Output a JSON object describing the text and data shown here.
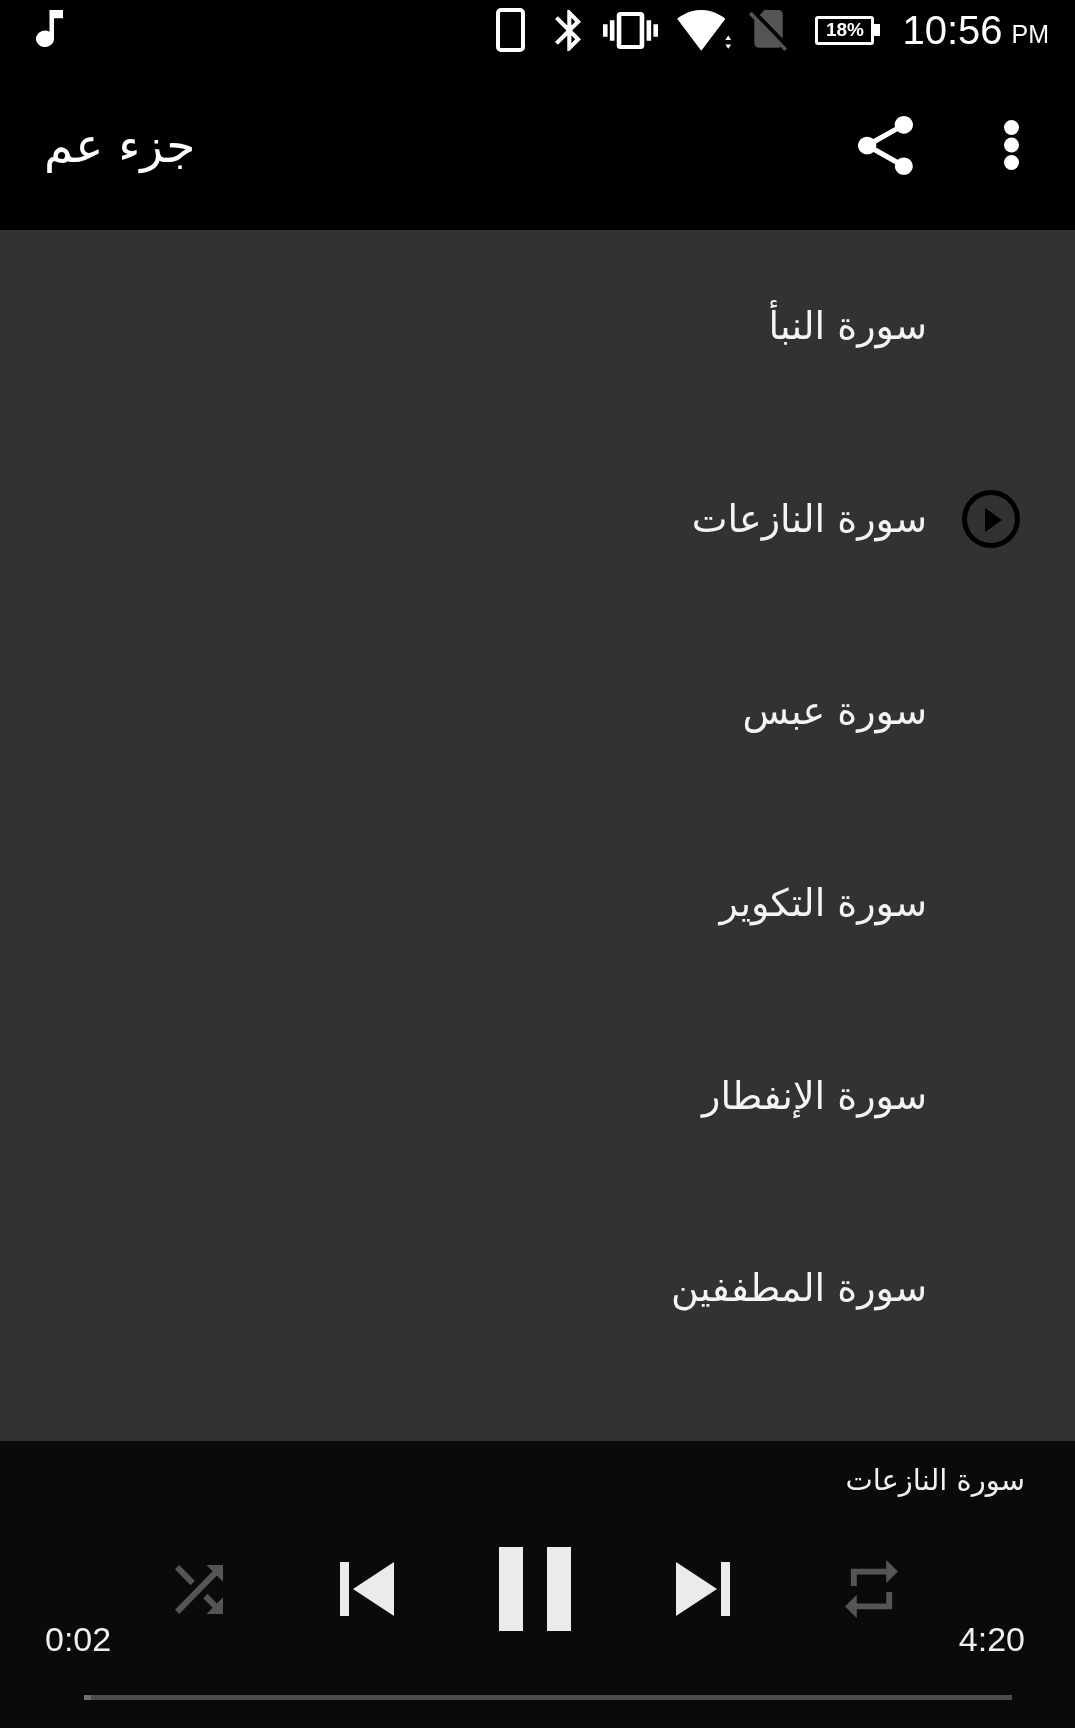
{
  "status_bar": {
    "battery": "18%",
    "time": "10:56",
    "period": "PM"
  },
  "app_bar": {
    "title": "جزء عم"
  },
  "surahs": [
    {
      "title": "سورة النبأ",
      "playing": false
    },
    {
      "title": "سورة النازعات",
      "playing": true
    },
    {
      "title": "سورة عبس",
      "playing": false
    },
    {
      "title": "سورة التكوير",
      "playing": false
    },
    {
      "title": "سورة الإنفطار",
      "playing": false
    },
    {
      "title": "سورة المطففين",
      "playing": false
    }
  ],
  "player": {
    "title": "سورة النازعات",
    "elapsed": "0:02",
    "duration": "4:20",
    "level": 0.008,
    "playing": true,
    "shuffle": false,
    "repeat": false
  }
}
